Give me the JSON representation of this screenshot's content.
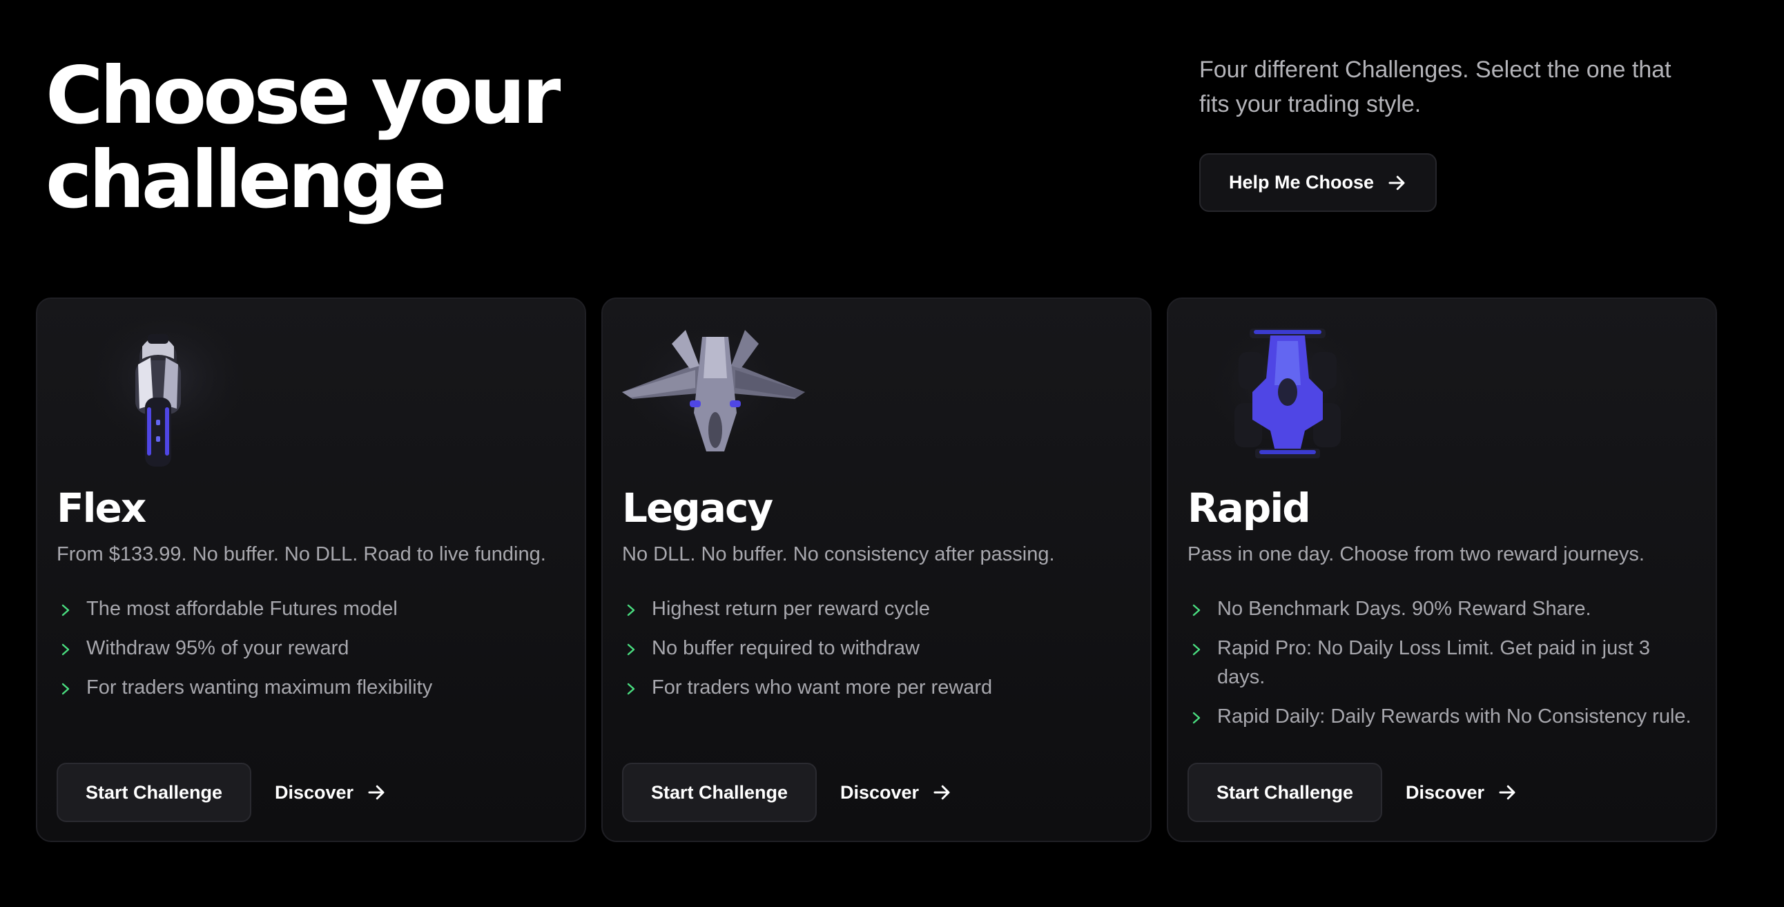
{
  "header": {
    "headline_line1": "Choose your",
    "headline_line2": "challenge",
    "intro_text": "Four different Challenges. Select the one that fits your trading style.",
    "help_button_label": "Help Me Choose"
  },
  "cards": [
    {
      "title": "Flex",
      "image_icon": "motorcycle-icon",
      "subtitle": "From $133.99. No buffer. No DLL. Road to live funding.",
      "features": [
        "The most affordable Futures model",
        "Withdraw 95% of your reward",
        "For traders wanting maximum flexibility"
      ],
      "start_label": "Start Challenge",
      "discover_label": "Discover"
    },
    {
      "title": "Legacy",
      "image_icon": "fighter-jet-icon",
      "subtitle": "No DLL. No buffer. No consistency after passing.",
      "features": [
        "Highest return per reward cycle",
        "No buffer required to withdraw",
        "For traders who want more per reward"
      ],
      "start_label": "Start Challenge",
      "discover_label": "Discover"
    },
    {
      "title": "Rapid",
      "image_icon": "race-car-icon",
      "subtitle": "Pass in one day. Choose from two reward journeys.",
      "features": [
        "No Benchmark Days. 90% Reward Share.",
        "Rapid Pro: No Daily Loss Limit. Get paid in just 3 days.",
        "Rapid Daily: Daily Rewards with No Consistency rule."
      ],
      "start_label": "Start Challenge",
      "discover_label": "Discover"
    }
  ],
  "colors": {
    "background": "#000000",
    "card_background": "#141417",
    "button_background": "#1c1c20",
    "chevron_accent": "#4ade80",
    "vehicle_accent": "#4f46e5",
    "muted_text": "#a8a8ae"
  }
}
